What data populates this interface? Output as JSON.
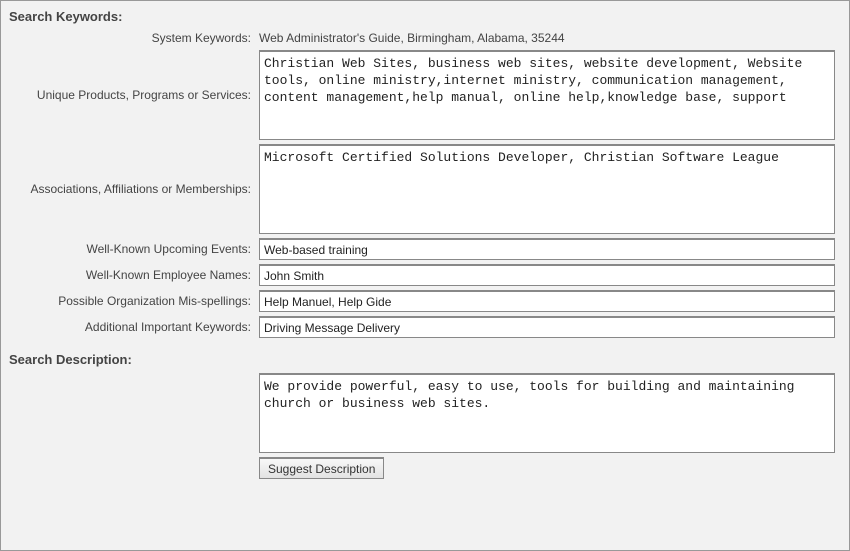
{
  "sections": {
    "keywords_title": "Search Keywords:",
    "description_title": "Search Description:"
  },
  "labels": {
    "system_keywords": "System Keywords:",
    "unique_products": "Unique Products, Programs or Services:",
    "associations": "Associations, Affiliations or Memberships:",
    "upcoming_events": "Well-Known Upcoming Events:",
    "employee_names": "Well-Known Employee Names:",
    "misspellings": "Possible Organization Mis-spellings:",
    "additional_keywords": "Additional Important Keywords:"
  },
  "values": {
    "system_keywords": "Web Administrator's Guide, Birmingham, Alabama, 35244",
    "unique_products": "Christian Web Sites, business web sites, website development, Website tools, online ministry,internet ministry, communication management, content management,help manual, online help,knowledge base, support",
    "associations": "Microsoft Certified Solutions Developer, Christian Software League",
    "upcoming_events": "Web-based training",
    "employee_names": "John Smith",
    "misspellings": "Help Manuel, Help Gide",
    "additional_keywords": "Driving Message Delivery",
    "description": "We provide powerful, easy to use, tools for building and maintaining church or business web sites."
  },
  "buttons": {
    "suggest_description": "Suggest Description"
  }
}
